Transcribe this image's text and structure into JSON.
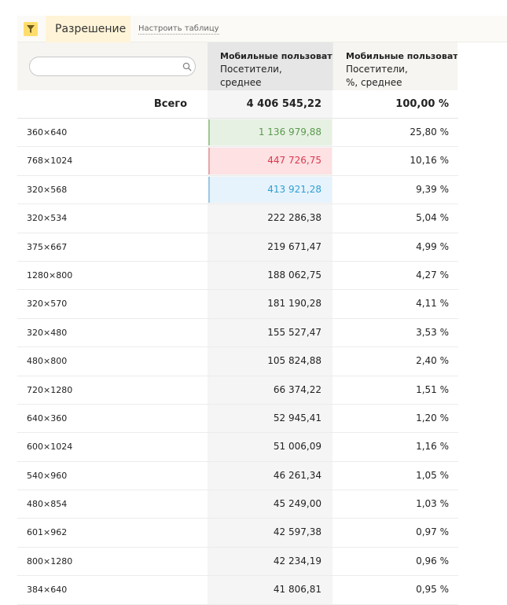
{
  "toolbar": {
    "dimension_label": "Разрешение",
    "configure_label": "Настроить таблицу",
    "icon": "filter-icon"
  },
  "table": {
    "search": {
      "value": "",
      "placeholder": ""
    },
    "columns": [
      {
        "title": "Мобильные пользоватe",
        "sub1": "Посетители,",
        "sub2": "среднее"
      },
      {
        "title": "Мобильные пользоватe",
        "sub1": "Посетители,",
        "sub2": "%, среднее"
      }
    ],
    "total": {
      "label": "Всего",
      "visitors": "4 406 545,22",
      "share": "100,00 %"
    },
    "rows": [
      {
        "resolution": "360×640",
        "visitors": "1 136 979,88",
        "share": "25,80 %"
      },
      {
        "resolution": "768×1024",
        "visitors": "447 726,75",
        "share": "10,16 %"
      },
      {
        "resolution": "320×568",
        "visitors": "413 921,28",
        "share": "9,39 %"
      },
      {
        "resolution": "320×534",
        "visitors": "222 286,38",
        "share": "5,04 %"
      },
      {
        "resolution": "375×667",
        "visitors": "219 671,47",
        "share": "4,99 %"
      },
      {
        "resolution": "1280×800",
        "visitors": "188 062,75",
        "share": "4,27 %"
      },
      {
        "resolution": "320×570",
        "visitors": "181 190,28",
        "share": "4,11 %"
      },
      {
        "resolution": "320×480",
        "visitors": "155 527,47",
        "share": "3,53 %"
      },
      {
        "resolution": "480×800",
        "visitors": "105 824,88",
        "share": "2,40 %"
      },
      {
        "resolution": "720×1280",
        "visitors": "66 374,22",
        "share": "1,51 %"
      },
      {
        "resolution": "640×360",
        "visitors": "52 945,41",
        "share": "1,20 %"
      },
      {
        "resolution": "600×1024",
        "visitors": "51 006,09",
        "share": "1,16 %"
      },
      {
        "resolution": "540×960",
        "visitors": "46 261,34",
        "share": "1,05 %"
      },
      {
        "resolution": "480×854",
        "visitors": "45 249,00",
        "share": "1,03 %"
      },
      {
        "resolution": "601×962",
        "visitors": "42 597,38",
        "share": "0,97 %"
      },
      {
        "resolution": "800×1280",
        "visitors": "42 234,19",
        "share": "0,96 %"
      },
      {
        "resolution": "384×640",
        "visitors": "41 806,81",
        "share": "0,95 %"
      }
    ]
  },
  "colors": {
    "highlight_green": "#5a9a4f",
    "highlight_red": "#d8394f",
    "highlight_blue": "#2e9fd3",
    "accent_yellow": "#ffdd6d"
  }
}
